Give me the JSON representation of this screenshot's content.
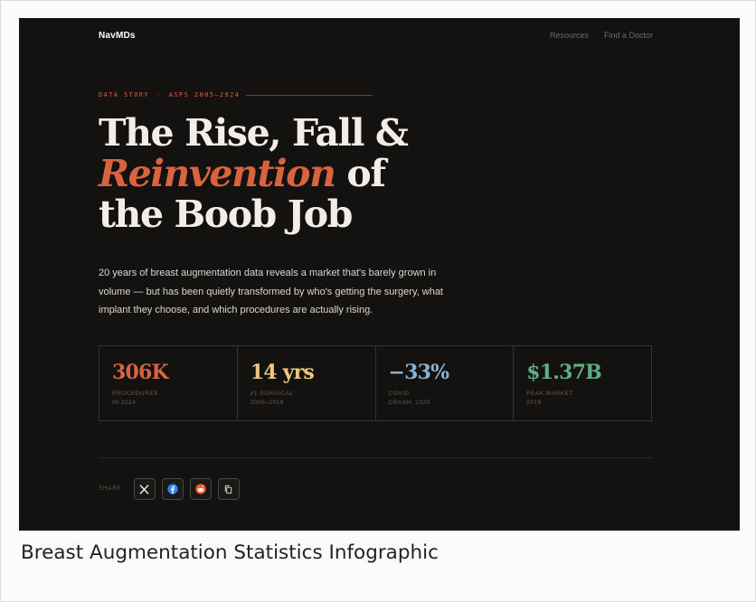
{
  "nav": {
    "brand": "NavMDs",
    "links": [
      {
        "label": "Resources"
      },
      {
        "label": "Find a Doctor"
      }
    ]
  },
  "hero": {
    "eyebrow": {
      "left": "DATA STORY",
      "separator": "·",
      "right": "ASPS 2005–2024"
    },
    "headline": {
      "line1": "The Rise, Fall &",
      "accent": "Reinvention",
      "line2_rest": " of",
      "line3": "the Boob Job"
    },
    "lede": "20 years of breast augmentation data reveals a market that's barely grown in volume — but has been quietly transformed by who's getting the surgery, what implant they choose, and which procedures are actually rising."
  },
  "stats": [
    {
      "value": "306K",
      "label": "PROCEDURES\nIN 2024",
      "color": "#d9633e"
    },
    {
      "value": "14 yrs",
      "label": "#1 SURGICAL\n2006–2019",
      "color": "#efc77a"
    },
    {
      "value": "−33%",
      "label": "COVID\nCRASH, 2020",
      "color": "#8ab3d1"
    },
    {
      "value": "$1.37B",
      "label": "PEAK MARKET\n2019",
      "color": "#5fae82"
    }
  ],
  "share": {
    "label": "SHARE",
    "buttons": [
      {
        "icon": "x-logo-icon",
        "label": "Share on X"
      },
      {
        "icon": "facebook-icon",
        "label": "Share on Facebook",
        "color": "#2d82f5"
      },
      {
        "icon": "reddit-icon",
        "label": "Share on Reddit",
        "color": "#ff5a1f"
      },
      {
        "icon": "copy-icon",
        "label": "Copy link"
      }
    ]
  },
  "caption": "Breast Augmentation Statistics Infographic"
}
